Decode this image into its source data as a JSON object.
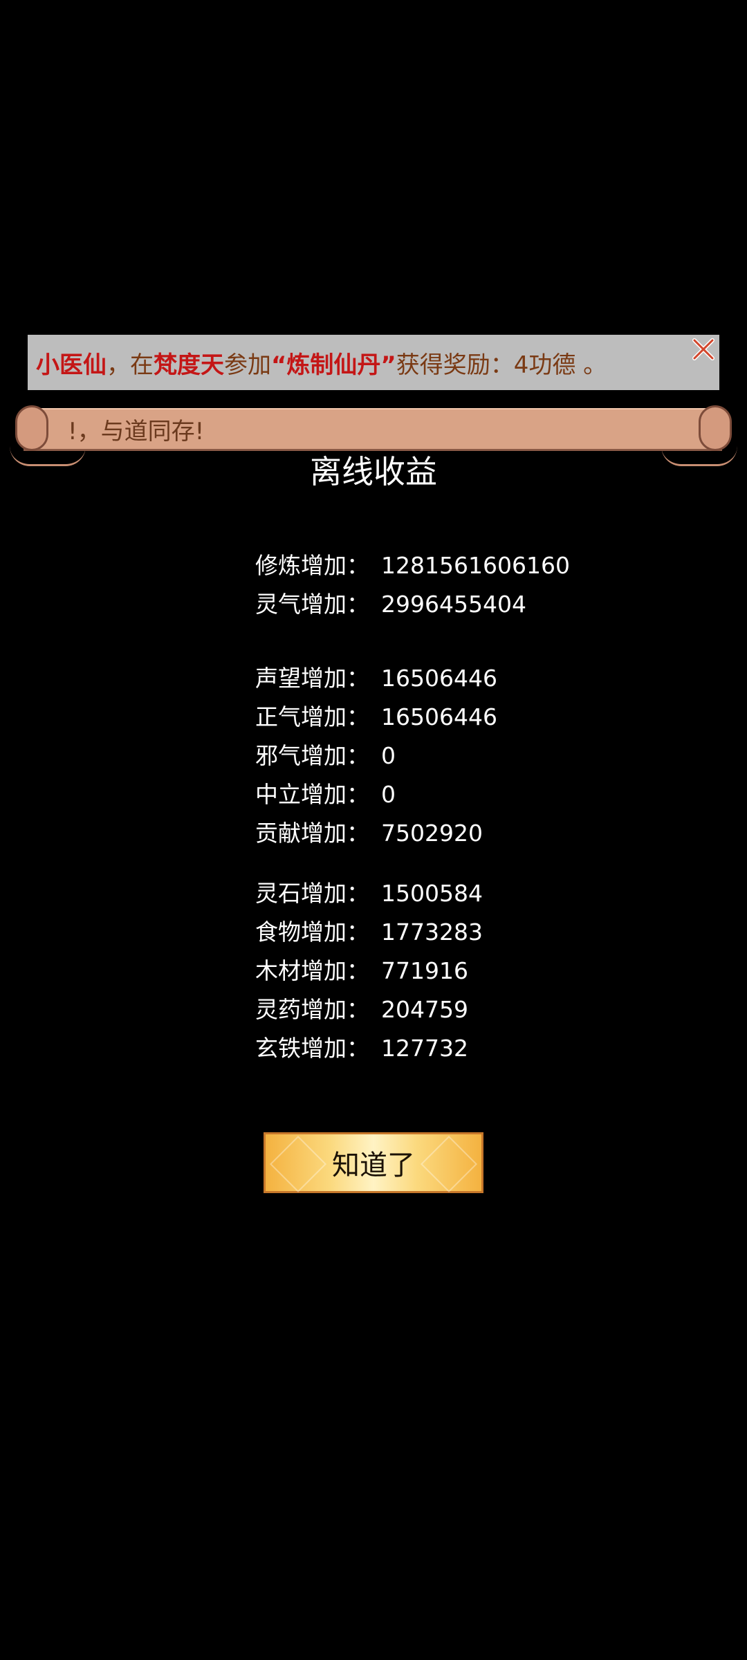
{
  "notice": {
    "player": "小医仙",
    "sep1": "，在",
    "place": "梵度天",
    "sep2": "参加",
    "event": "“炼制仙丹”",
    "sep3": "获得奖励：4功德 。",
    "close_icon": "close-icon"
  },
  "scroll": {
    "text": "!，与道同存!"
  },
  "title": "离线收益",
  "stats": [
    {
      "label": "修炼增加：",
      "value": "1281561606160"
    },
    {
      "label": "灵气增加：",
      "value": "2996455404"
    },
    {
      "label": "声望增加：",
      "value": "16506446"
    },
    {
      "label": "正气增加：",
      "value": "16506446"
    },
    {
      "label": "邪气增加：",
      "value": "0"
    },
    {
      "label": "中立增加：",
      "value": "0"
    },
    {
      "label": "贡献增加：",
      "value": "7502920"
    },
    {
      "label": "灵石增加：",
      "value": "1500584"
    },
    {
      "label": "食物增加：",
      "value": "1773283"
    },
    {
      "label": "木材增加：",
      "value": "771916"
    },
    {
      "label": "灵药增加：",
      "value": "204759"
    },
    {
      "label": "玄铁增加：",
      "value": "127732"
    }
  ],
  "button": {
    "label": "知道了"
  },
  "colors": {
    "notice_red": "#c41616",
    "notice_brown": "#7a3a14",
    "button_gold": "#f4b240"
  }
}
